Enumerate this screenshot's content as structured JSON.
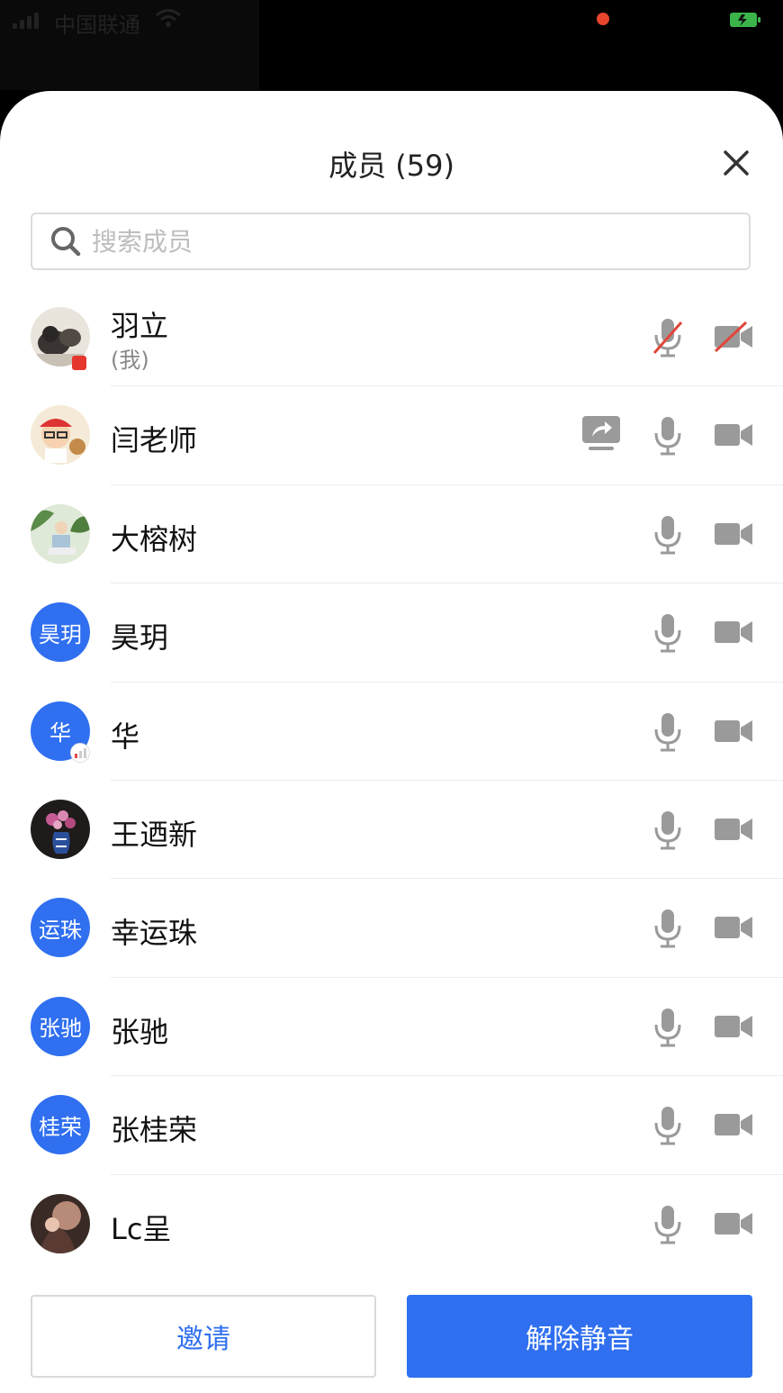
{
  "status_bar": {
    "carrier": "中国联通",
    "icons": [
      "signal-icon",
      "wifi-icon",
      "recording-dot",
      "battery-icon"
    ]
  },
  "panel": {
    "title": "成员 (59)",
    "close_icon": "close-icon"
  },
  "search": {
    "placeholder": "搜索成员",
    "value": ""
  },
  "members": [
    {
      "name": "羽立",
      "tag": "(我)",
      "avatar": "photo-cats",
      "mic": "muted",
      "camera": "off"
    },
    {
      "name": "闫老师",
      "avatar": "photo-cartoon",
      "sharing": true,
      "mic": "on",
      "camera": "on"
    },
    {
      "name": "大榕树",
      "avatar": "photo-forest",
      "mic": "on",
      "camera": "on"
    },
    {
      "name": "昊玥",
      "avatar_text": "昊玥",
      "mic": "on",
      "camera": "on"
    },
    {
      "name": "华",
      "avatar_text": "华",
      "mic": "on",
      "camera": "on"
    },
    {
      "name": "王迺新",
      "avatar": "photo-flowers",
      "mic": "on",
      "camera": "on"
    },
    {
      "name": "幸运珠",
      "avatar_text": "运珠",
      "mic": "on",
      "camera": "on"
    },
    {
      "name": "张驰",
      "avatar_text": "张驰",
      "mic": "on",
      "camera": "on"
    },
    {
      "name": "张桂荣",
      "avatar_text": "桂荣",
      "mic": "on",
      "camera": "on"
    },
    {
      "name": "Lc呈",
      "avatar": "photo-dark",
      "mic": "on",
      "camera": "on"
    }
  ],
  "footer": {
    "invite_label": "邀请",
    "unmute_label": "解除静音"
  },
  "colors": {
    "accent": "#2f6ff0",
    "icon_gray": "#9a9a9a",
    "muted_red": "#e0463a"
  }
}
